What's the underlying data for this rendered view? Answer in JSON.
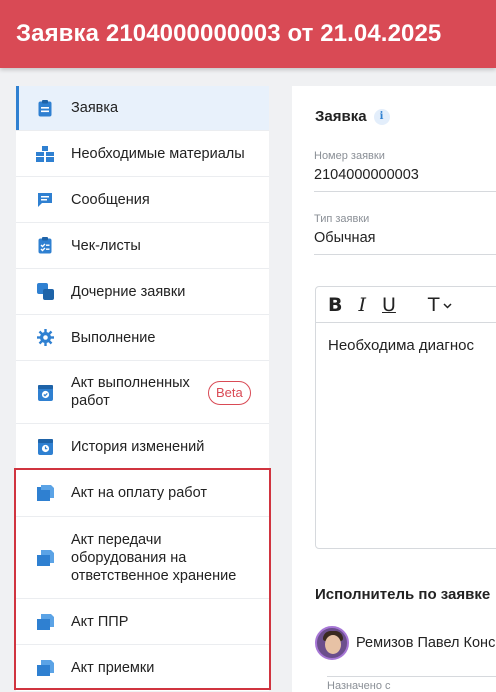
{
  "header": {
    "title": "Заявка 2104000000003 от 21.04.2025"
  },
  "colors": {
    "header_bg": "#d94a55",
    "accent": "#2f80d1",
    "highlight": "#d0343f",
    "icon": "#2f80d1"
  },
  "sidebar": {
    "items": [
      {
        "label": "Заявка",
        "icon": "clipboard-icon",
        "active": true
      },
      {
        "label": "Необходимые материалы",
        "icon": "materials-icon"
      },
      {
        "label": "Сообщения",
        "icon": "chat-icon"
      },
      {
        "label": "Чек-листы",
        "icon": "checklist-icon"
      },
      {
        "label": "Дочерние заявки",
        "icon": "child-requests-icon"
      },
      {
        "label": "Выполнение",
        "icon": "gear-icon"
      },
      {
        "label": "Акт выполненных работ",
        "icon": "act-done-icon",
        "badge": "Beta"
      },
      {
        "label": "История изменений",
        "icon": "history-icon"
      },
      {
        "label": "Акт на оплату работ",
        "icon": "document-icon"
      },
      {
        "label": "Акт передачи оборудования на ответственное хранение",
        "icon": "document-icon"
      },
      {
        "label": "Акт ППР",
        "icon": "document-icon"
      },
      {
        "label": "Акт приемки",
        "icon": "document-icon"
      }
    ]
  },
  "main": {
    "section_title": "Заявка",
    "info_glyph": "i",
    "fields": {
      "number": {
        "label": "Номер заявки",
        "value": "2104000000003"
      },
      "type": {
        "label": "Тип заявки",
        "value": "Обычная"
      }
    },
    "editor": {
      "bold": "B",
      "italic": "I",
      "underline": "U",
      "text_style": "T",
      "text": "Необходима диагнос"
    },
    "executor": {
      "title": "Исполнитель по заявке",
      "name": "Ремизов Павел Конс"
    },
    "assigned_label": "Назначено с"
  }
}
